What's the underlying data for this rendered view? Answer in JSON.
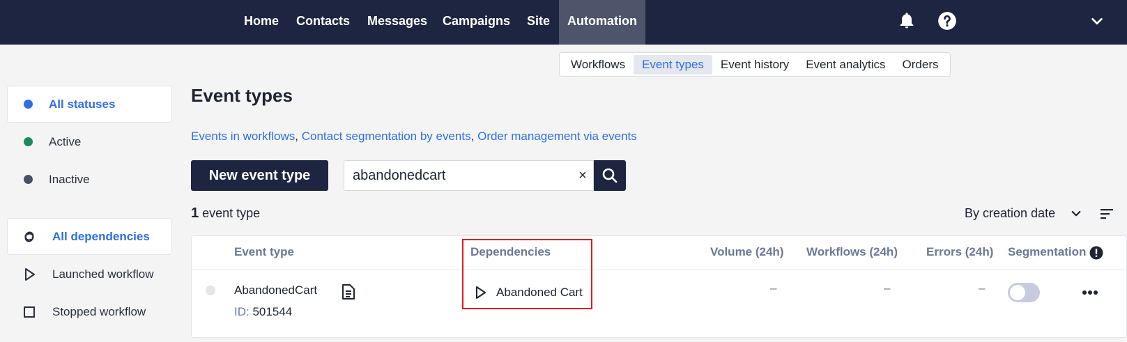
{
  "topnav": {
    "items": [
      {
        "label": "Home"
      },
      {
        "label": "Contacts"
      },
      {
        "label": "Messages"
      },
      {
        "label": "Campaigns"
      },
      {
        "label": "Site"
      },
      {
        "label": "Automation",
        "active": true
      }
    ],
    "icons": [
      "bell-icon",
      "help-icon",
      "chevron-down-icon"
    ]
  },
  "subnav": {
    "items": [
      {
        "label": "Workflows"
      },
      {
        "label": "Event types",
        "active": true
      },
      {
        "label": "Event history"
      },
      {
        "label": "Event analytics"
      },
      {
        "label": "Orders"
      }
    ]
  },
  "sidebar": {
    "statuses": [
      {
        "label": "All statuses",
        "color": "#2f6fe0",
        "active": true
      },
      {
        "label": "Active",
        "color": "#1c8a5c"
      },
      {
        "label": "Inactive",
        "color": "#4a5068"
      }
    ],
    "dependencies": [
      {
        "label": "All dependencies",
        "icon": "link-icon",
        "active": true
      },
      {
        "label": "Launched workflow",
        "icon": "play-icon"
      },
      {
        "label": "Stopped workflow",
        "icon": "stop-icon"
      }
    ]
  },
  "main": {
    "title": "Event types",
    "links": [
      "Events in workflows",
      "Contact segmentation by events",
      "Order management via events"
    ],
    "link_separator": ",",
    "new_button": "New event type",
    "search": {
      "value": "abandonedcart",
      "clear": "×"
    },
    "count": {
      "number": "1",
      "label": "event type"
    },
    "sort": {
      "label": "By creation date"
    }
  },
  "table": {
    "columns": [
      "Event type",
      "Dependencies",
      "Volume (24h)",
      "Workflows (24h)",
      "Errors (24h)",
      "Segmentation"
    ],
    "rows": [
      {
        "name": "AbandonedCart",
        "id_label": "ID:",
        "id": "501544",
        "dependency": "Abandoned Cart",
        "volume": "–",
        "workflows": "–",
        "errors": "–",
        "segmentation_enabled": false
      }
    ]
  },
  "colors": {
    "nav_bg": "#1e2541",
    "accent": "#2f6fe0",
    "highlight": "#e01a22"
  }
}
